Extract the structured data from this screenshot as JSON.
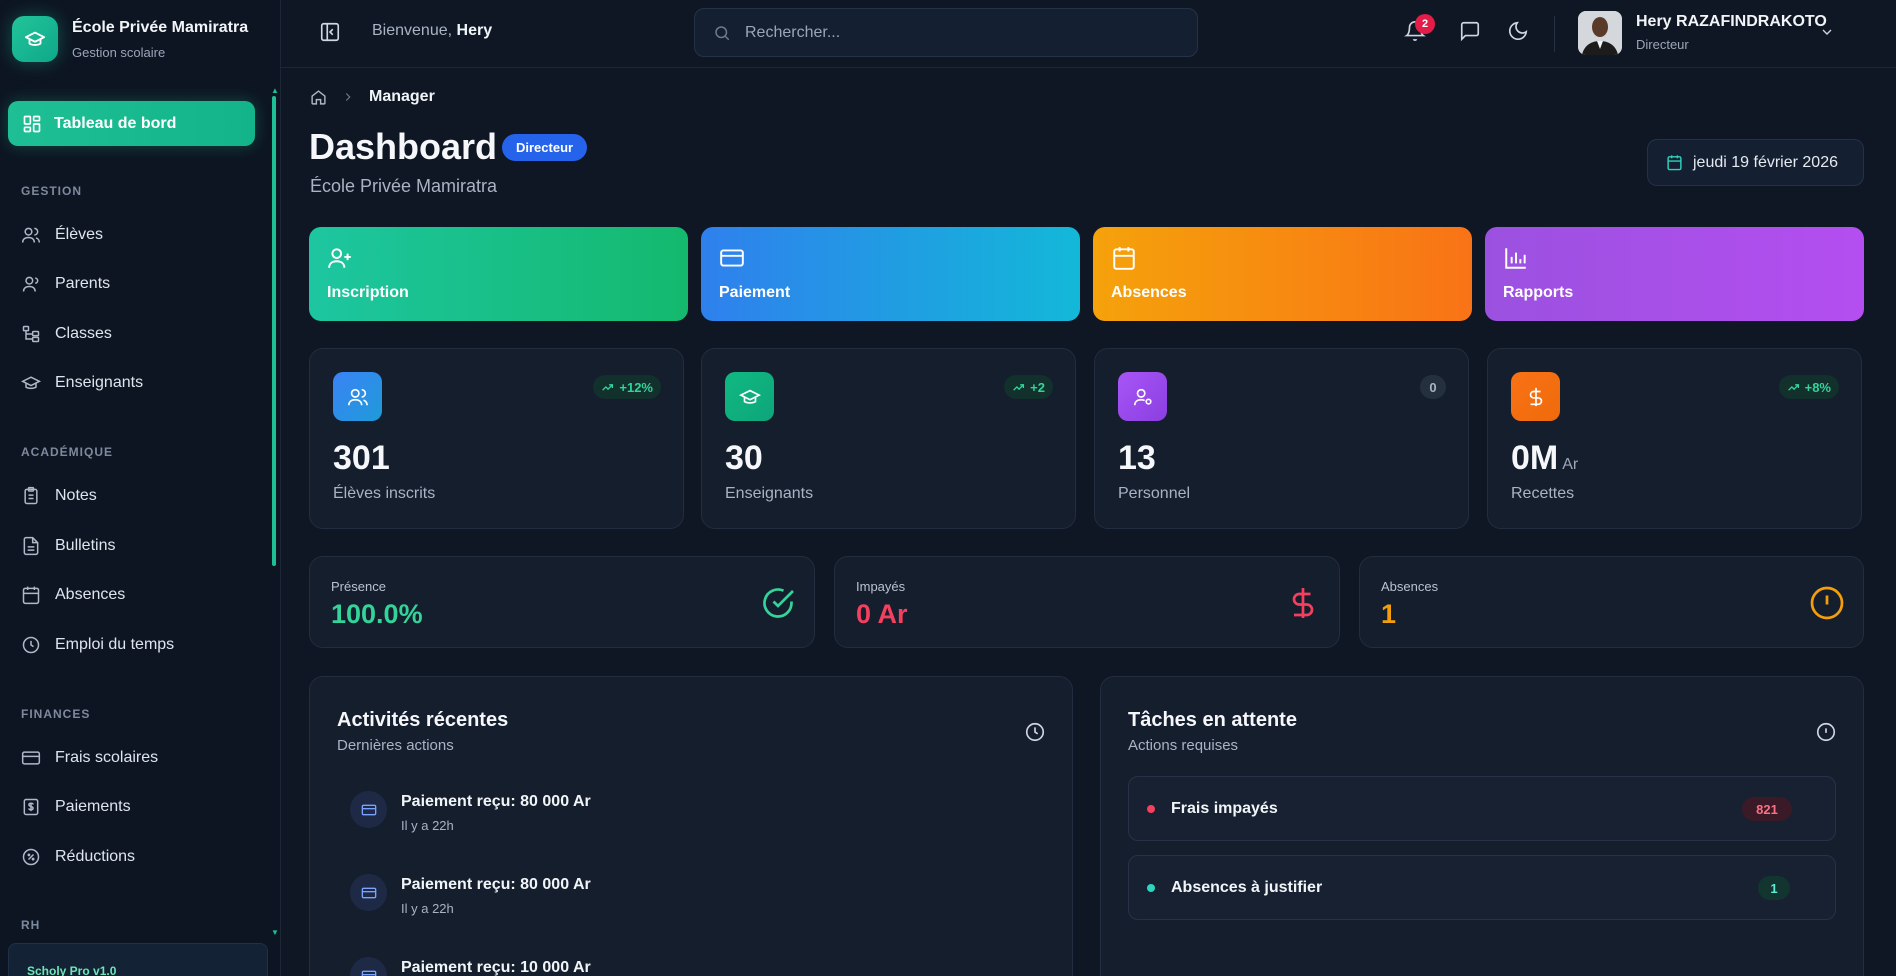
{
  "app": {
    "school_name": "École Privée Mamiratra",
    "school_sub": "Gestion scolaire",
    "footer": "Scholy Pro v1.0"
  },
  "sidebar": {
    "active": {
      "label": "Tableau de bord",
      "icon": "dashboard-icon"
    },
    "sections": [
      {
        "title": "GESTION",
        "items": [
          {
            "label": "Élèves",
            "icon": "users-icon"
          },
          {
            "label": "Parents",
            "icon": "user-icon"
          },
          {
            "label": "Classes",
            "icon": "tree-icon"
          },
          {
            "label": "Enseignants",
            "icon": "graduation-cap-icon"
          }
        ]
      },
      {
        "title": "ACADÉMIQUE",
        "items": [
          {
            "label": "Notes",
            "icon": "clipboard-icon"
          },
          {
            "label": "Bulletins",
            "icon": "file-icon"
          },
          {
            "label": "Absences",
            "icon": "calendar-icon"
          },
          {
            "label": "Emploi du temps",
            "icon": "clock-icon"
          }
        ]
      },
      {
        "title": "FINANCES",
        "items": [
          {
            "label": "Frais scolaires",
            "icon": "card-icon"
          },
          {
            "label": "Paiements",
            "icon": "receipt-icon"
          },
          {
            "label": "Réductions",
            "icon": "discount-icon"
          }
        ]
      },
      {
        "title": "RH",
        "items": []
      }
    ]
  },
  "header": {
    "welcome_prefix": "Bienvenue,",
    "welcome_name": "Hery",
    "search_placeholder": "Rechercher...",
    "notification_count": "2",
    "user_name": "Hery RAZAFINDRAKOTO",
    "user_role": "Directeur"
  },
  "breadcrumb": {
    "current": "Manager"
  },
  "page": {
    "title": "Dashboard",
    "role_badge": "Directeur",
    "subtitle": "École Privée Mamiratra",
    "date": "jeudi 19 février 2026"
  },
  "quick_actions": [
    {
      "label": "Inscription",
      "icon": "user-plus-icon"
    },
    {
      "label": "Paiement",
      "icon": "card-icon"
    },
    {
      "label": "Absences",
      "icon": "calendar-icon"
    },
    {
      "label": "Rapports",
      "icon": "bar-chart-icon"
    }
  ],
  "stats": [
    {
      "value": "301",
      "unit": "",
      "label": "Élèves inscrits",
      "trend": "+12%",
      "color": "#3b82f6"
    },
    {
      "value": "30",
      "unit": "",
      "label": "Enseignants",
      "trend": "+2",
      "color": "#10b981"
    },
    {
      "value": "13",
      "unit": "",
      "label": "Personnel",
      "trend": "0",
      "color": "#a855f7"
    },
    {
      "value": "0M",
      "unit": "Ar",
      "label": "Recettes",
      "trend": "+8%",
      "color": "#f97316"
    }
  ],
  "summary": [
    {
      "label": "Présence",
      "value": "100.0%",
      "color": "#34d399"
    },
    {
      "label": "Impayés",
      "value": "0 Ar",
      "color": "#f43f5e"
    },
    {
      "label": "Absences",
      "value": "1",
      "color": "#f59e0b"
    }
  ],
  "activities": {
    "title": "Activités récentes",
    "subtitle": "Dernières actions",
    "items": [
      {
        "title": "Paiement reçu: 80 000 Ar",
        "time": "Il y a 22h"
      },
      {
        "title": "Paiement reçu: 80 000 Ar",
        "time": "Il y a 22h"
      },
      {
        "title": "Paiement reçu: 10 000 Ar",
        "time": ""
      }
    ]
  },
  "tasks": {
    "title": "Tâches en attente",
    "subtitle": "Actions requises",
    "items": [
      {
        "label": "Frais impayés",
        "count": "821",
        "color": "#f43f5e"
      },
      {
        "label": "Absences à justifier",
        "count": "1",
        "color": "#2dd4bf"
      }
    ]
  }
}
